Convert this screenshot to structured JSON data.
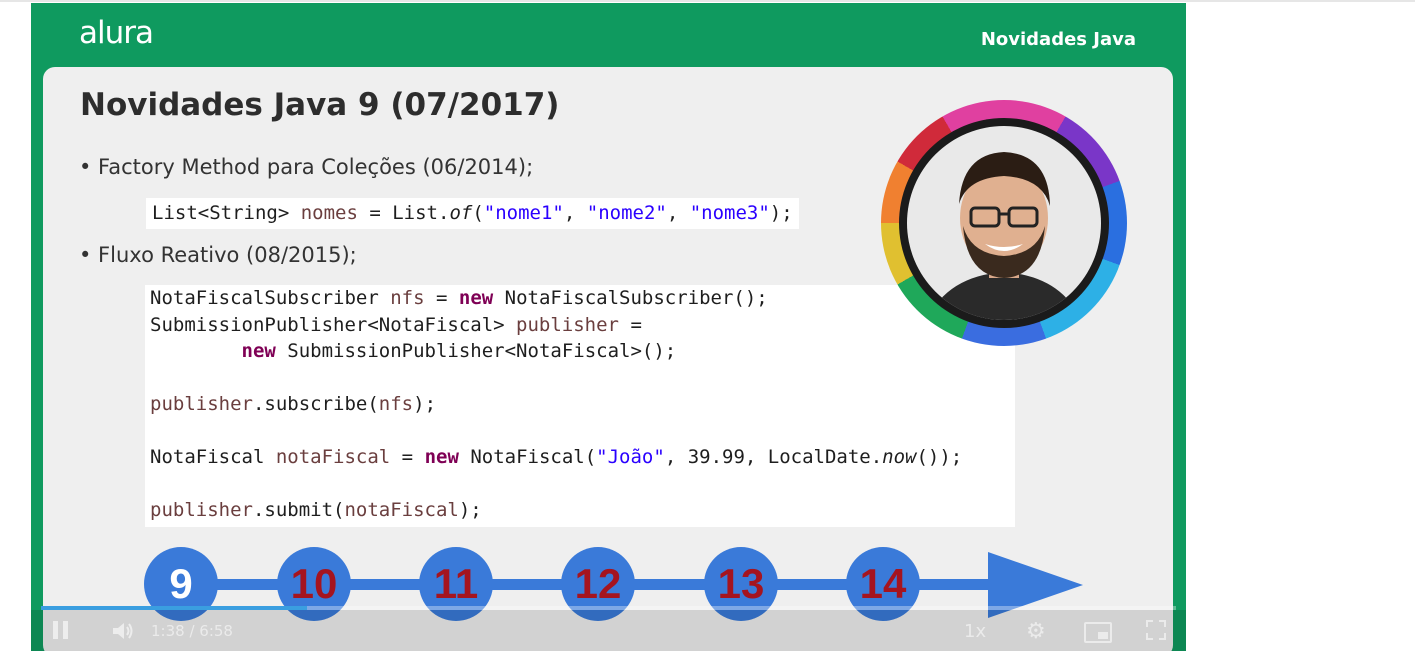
{
  "header": {
    "brand": "alura",
    "course_title": "Novidades Java"
  },
  "slide": {
    "title": "Novidades Java 9 (07/2017)",
    "bullet1": "• Factory Method para Coleções (06/2014);",
    "bullet2": "• Fluxo Reativo (08/2015);"
  },
  "code1": {
    "a": "List<String> ",
    "var": "nomes",
    "b": " = List.",
    "of": "of",
    "c": "(",
    "s1": "\"nome1\"",
    "s2": "\"nome2\"",
    "s3": "\"nome3\"",
    "comma": ", ",
    "end": ");"
  },
  "code2": {
    "l1_a": "NotaFiscalSubscriber ",
    "l1_var": "nfs",
    "l1_b": " = ",
    "kw_new": "new",
    "l1_c": " NotaFiscalSubscriber();",
    "l2_a": "SubmissionPublisher<NotaFiscal> ",
    "l2_var": "publisher",
    "l2_b": " =",
    "l3_indent": "        ",
    "l3_c": " SubmissionPublisher<NotaFiscal>();",
    "l4_var": "publisher",
    "l4_b": ".subscribe(",
    "l4_var2": "nfs",
    "l4_c": ");",
    "l5_a": "NotaFiscal ",
    "l5_var": "notaFiscal",
    "l5_b": " = ",
    "l5_c": " NotaFiscal(",
    "l5_str": "\"João\"",
    "l5_d": ", 39.99, LocalDate.",
    "l5_now": "now",
    "l5_e": "());",
    "l6_var": "publisher",
    "l6_b": ".submit(",
    "l6_var2": "notaFiscal",
    "l6_c": ");"
  },
  "timeline": {
    "versions": [
      "9",
      "10",
      "11",
      "12",
      "13",
      "14"
    ],
    "current": "9",
    "color": "#3a7ad9"
  },
  "player": {
    "current_time": "1:38",
    "separator": " / ",
    "duration": "6:58",
    "speed": "1x",
    "progress_fraction": 0.234
  },
  "colors": {
    "frame": "#0f9a5f",
    "slide_bg": "#efefef",
    "keyword": "#7f0055",
    "string": "#2a00ff"
  }
}
